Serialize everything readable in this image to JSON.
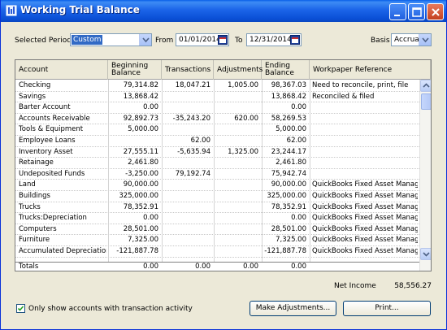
{
  "window": {
    "title": "Working Trial Balance"
  },
  "filter": {
    "period_label": "Selected Period",
    "period_value": "Custom",
    "from_label": "From",
    "from_value": "01/01/2014",
    "to_label": "To",
    "to_value": "12/31/2014",
    "basis_label": "Basis",
    "basis_value": "Accrual"
  },
  "table": {
    "columns": [
      "Account",
      "Beginning Balance",
      "Transactions",
      "Adjustments",
      "Ending Balance",
      "Workpaper Reference"
    ],
    "rows": [
      {
        "account": "Checking",
        "begin": "79,314.82",
        "trans": "18,047.21",
        "adj": "1,005.00",
        "end": "98,367.03",
        "ref": "Need to reconcile, print, file"
      },
      {
        "account": "Savings",
        "begin": "13,868.42",
        "trans": "",
        "adj": "",
        "end": "13,868.42",
        "ref": "Reconciled & filed"
      },
      {
        "account": "Barter Account",
        "begin": "0.00",
        "trans": "",
        "adj": "",
        "end": "0.00",
        "ref": ""
      },
      {
        "account": "Accounts Receivable",
        "begin": "92,892.73",
        "trans": "-35,243.20",
        "adj": "620.00",
        "end": "58,269.53",
        "ref": ""
      },
      {
        "account": "Tools & Equipment",
        "begin": "5,000.00",
        "trans": "",
        "adj": "",
        "end": "5,000.00",
        "ref": ""
      },
      {
        "account": "Employee Loans",
        "begin": "",
        "trans": "62.00",
        "adj": "",
        "end": "62.00",
        "ref": ""
      },
      {
        "account": "Inventory Asset",
        "begin": "27,555.11",
        "trans": "-5,635.94",
        "adj": "1,325.00",
        "end": "23,244.17",
        "ref": ""
      },
      {
        "account": "Retainage",
        "begin": "2,461.80",
        "trans": "",
        "adj": "",
        "end": "2,461.80",
        "ref": ""
      },
      {
        "account": "Undeposited Funds",
        "begin": "-3,250.00",
        "trans": "79,192.74",
        "adj": "",
        "end": "75,942.74",
        "ref": ""
      },
      {
        "account": "Land",
        "begin": "90,000.00",
        "trans": "",
        "adj": "",
        "end": "90,000.00",
        "ref": "QuickBooks Fixed Asset Manager"
      },
      {
        "account": "Buildings",
        "begin": "325,000.00",
        "trans": "",
        "adj": "",
        "end": "325,000.00",
        "ref": "QuickBooks Fixed Asset Manager"
      },
      {
        "account": "Trucks",
        "begin": "78,352.91",
        "trans": "",
        "adj": "",
        "end": "78,352.91",
        "ref": "QuickBooks Fixed Asset Manager"
      },
      {
        "account": "Trucks:Depreciation",
        "begin": "0.00",
        "trans": "",
        "adj": "",
        "end": "0.00",
        "ref": "QuickBooks Fixed Asset Manager"
      },
      {
        "account": "Computers",
        "begin": "28,501.00",
        "trans": "",
        "adj": "",
        "end": "28,501.00",
        "ref": "QuickBooks Fixed Asset Manager"
      },
      {
        "account": "Furniture",
        "begin": "7,325.00",
        "trans": "",
        "adj": "",
        "end": "7,325.00",
        "ref": "QuickBooks Fixed Asset Manager"
      },
      {
        "account": "Accumulated Depreciation",
        "begin": "-121,887.78",
        "trans": "",
        "adj": "",
        "end": "-121,887.78",
        "ref": "QuickBooks Fixed Asset Manager"
      }
    ],
    "totals": {
      "label": "Totals",
      "begin": "0.00",
      "trans": "0.00",
      "adj": "0.00",
      "end": "0.00"
    }
  },
  "summary": {
    "net_income_label": "Net Income",
    "net_income_value": "58,556.27"
  },
  "footer": {
    "only_activity_label": "Only show accounts with transaction activity",
    "only_activity_checked": true,
    "make_adjustments_label": "Make Adjustments...",
    "print_label": "Print..."
  },
  "colors": {
    "titlebar": "#0a4fd6",
    "selection": "#316ac5",
    "face": "#ece9d8"
  }
}
